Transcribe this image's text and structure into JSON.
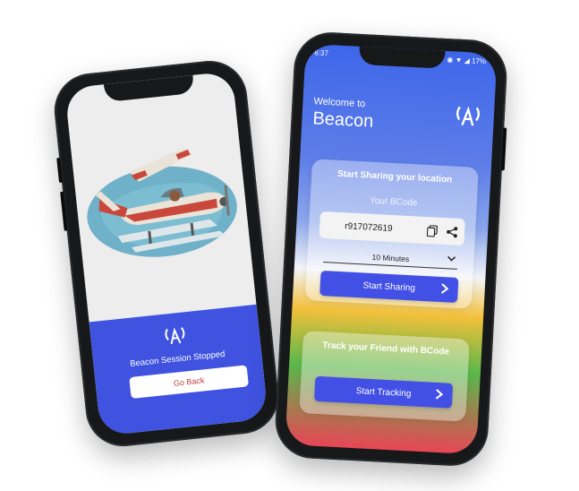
{
  "left_screen": {
    "status_message": "Beacon Session Stopped",
    "go_back_label": "Go Back",
    "icon": "beacon-antenna-icon",
    "colors": {
      "panel": "#3f53e0",
      "button_text": "#c0393b"
    }
  },
  "right_screen": {
    "status_bar": {
      "time": "6:37",
      "right": "◉ ▼ ◢ 17%"
    },
    "welcome_text": "Welcome to",
    "app_name": "Beacon",
    "header_icon": "beacon-antenna-icon",
    "share_card": {
      "title": "Start Sharing your location",
      "code_label": "Your BCode",
      "code_value": "r917072619",
      "copy_icon": "copy-icon",
      "share_icon": "share-icon",
      "duration_selected": "10 Minutes",
      "start_sharing_label": "Start Sharing"
    },
    "track_card": {
      "title": "Track your Friend with BCode",
      "start_tracking_label": "Start Tracking"
    },
    "colors": {
      "primary": "#4250e6",
      "header_blue": "#3e66ea"
    }
  }
}
